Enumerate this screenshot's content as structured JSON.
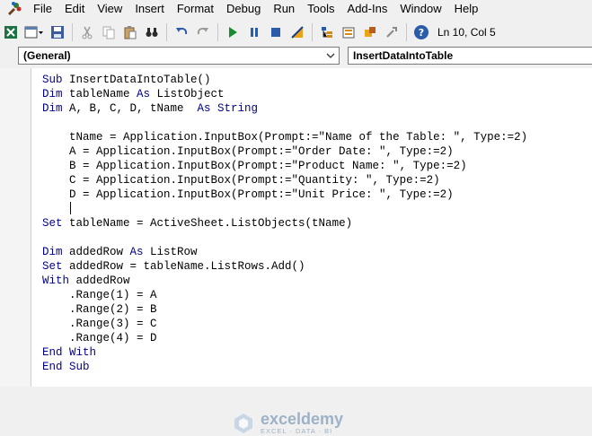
{
  "menu": {
    "file": "File",
    "edit": "Edit",
    "view": "View",
    "insert": "Insert",
    "format": "Format",
    "debug": "Debug",
    "run": "Run",
    "tools": "Tools",
    "addins": "Add-Ins",
    "window": "Window",
    "help": "Help"
  },
  "toolbar": {
    "status": "Ln 10, Col 5",
    "icons": [
      "excel-view-icon",
      "insert-userform-icon",
      "save-icon",
      "cut-icon",
      "copy-icon",
      "paste-icon",
      "find-icon",
      "undo-icon",
      "redo-icon",
      "run-icon",
      "break-icon",
      "reset-icon",
      "design-mode-icon",
      "project-explorer-icon",
      "properties-icon",
      "object-browser-icon",
      "toolbox-icon",
      "help-icon"
    ]
  },
  "combos": {
    "object": "(General)",
    "procedure": "InsertDataIntoTable"
  },
  "code": {
    "lines": [
      [
        {
          "t": "Sub ",
          "k": 1
        },
        {
          "t": "InsertDataIntoTable()",
          "k": 0
        }
      ],
      [
        {
          "t": "Dim ",
          "k": 1
        },
        {
          "t": "tableName ",
          "k": 0
        },
        {
          "t": "As ",
          "k": 1
        },
        {
          "t": "ListObject",
          "k": 0
        }
      ],
      [
        {
          "t": "Dim ",
          "k": 1
        },
        {
          "t": "A, B, C, D, tName  ",
          "k": 0
        },
        {
          "t": "As String",
          "k": 1
        }
      ],
      [],
      [
        {
          "t": "    tName = Application.InputBox(Prompt:=\"Name of the Table: \", Type:=2)",
          "k": 0
        }
      ],
      [
        {
          "t": "    A = Application.InputBox(Prompt:=\"Order Date: \", Type:=2)",
          "k": 0
        }
      ],
      [
        {
          "t": "    B = Application.InputBox(Prompt:=\"Product Name: \", Type:=2)",
          "k": 0
        }
      ],
      [
        {
          "t": "    C = Application.InputBox(Prompt:=\"Quantity: \", Type:=2)",
          "k": 0
        }
      ],
      [
        {
          "t": "    D = Application.InputBox(Prompt:=\"Unit Price: \", Type:=2)",
          "k": 0
        }
      ],
      [],
      [
        {
          "t": "Set ",
          "k": 1
        },
        {
          "t": "tableName = ActiveSheet.ListObjects(tName)",
          "k": 0
        }
      ],
      [],
      [
        {
          "t": "Dim ",
          "k": 1
        },
        {
          "t": "addedRow ",
          "k": 0
        },
        {
          "t": "As ",
          "k": 1
        },
        {
          "t": "ListRow",
          "k": 0
        }
      ],
      [
        {
          "t": "Set ",
          "k": 1
        },
        {
          "t": "addedRow = tableName.ListRows.Add()",
          "k": 0
        }
      ],
      [
        {
          "t": "With ",
          "k": 1
        },
        {
          "t": "addedRow",
          "k": 0
        }
      ],
      [
        {
          "t": "    .Range(1) = A",
          "k": 0
        }
      ],
      [
        {
          "t": "    .Range(2) = B",
          "k": 0
        }
      ],
      [
        {
          "t": "    .Range(3) = C",
          "k": 0
        }
      ],
      [
        {
          "t": "    .Range(4) = D",
          "k": 0
        }
      ],
      [
        {
          "t": "End With",
          "k": 1
        }
      ],
      [
        {
          "t": "End Sub",
          "k": 1
        }
      ]
    ]
  },
  "watermark": {
    "brand": "exceldemy",
    "tagline": "EXCEL · DATA · BI"
  },
  "colors": {
    "keyword": "#00008b",
    "background": "#f0f0f0"
  }
}
